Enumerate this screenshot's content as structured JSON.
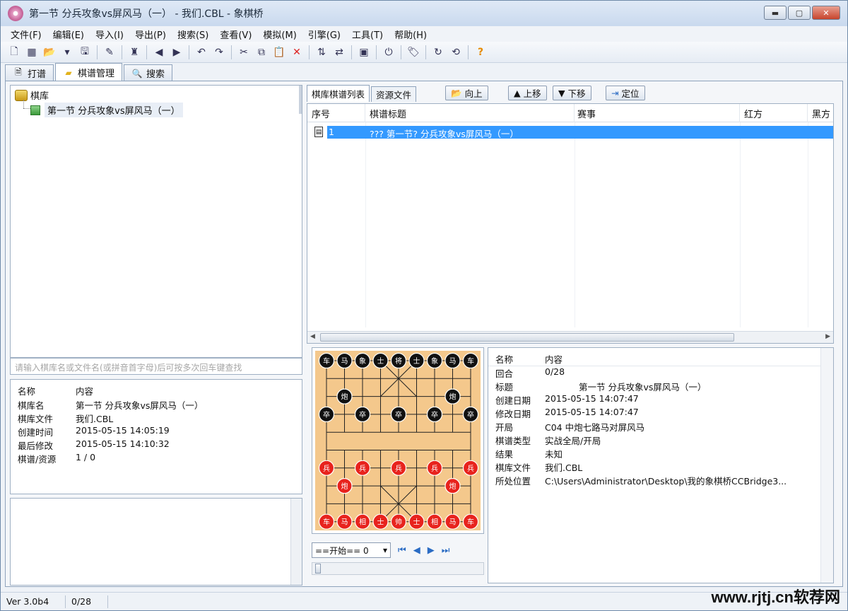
{
  "window": {
    "title": "第一节  分兵攻象vs屏风马（一） - 我们.CBL - 象棋桥",
    "controls": {
      "minimize": "▬",
      "maximize": "▢",
      "close": "✕"
    }
  },
  "menu": [
    "文件(F)",
    "编辑(E)",
    "导入(I)",
    "导出(P)",
    "搜索(S)",
    "查看(V)",
    "模拟(M)",
    "引擎(G)",
    "工具(T)",
    "帮助(H)"
  ],
  "toolbar": {
    "buttons": [
      {
        "name": "new-file-icon",
        "glyph": "🗋"
      },
      {
        "name": "board-icon",
        "glyph": "▦"
      },
      {
        "name": "open-icon",
        "glyph": "📂"
      },
      {
        "name": "dropdown-icon",
        "glyph": "▾"
      },
      {
        "name": "save-icon",
        "glyph": "🖫"
      },
      {
        "sep": true
      },
      {
        "name": "edit-icon",
        "glyph": "✎"
      },
      {
        "sep": true
      },
      {
        "name": "piece-icon",
        "glyph": "♜"
      },
      {
        "sep": true
      },
      {
        "name": "back-icon",
        "glyph": "◀"
      },
      {
        "name": "forward-icon",
        "glyph": "▶"
      },
      {
        "sep": true
      },
      {
        "name": "undo-icon",
        "glyph": "↶"
      },
      {
        "name": "redo-icon",
        "glyph": "↷"
      },
      {
        "sep": true
      },
      {
        "name": "cut-icon",
        "glyph": "✂"
      },
      {
        "name": "copy-icon",
        "glyph": "⧉"
      },
      {
        "name": "paste-icon",
        "glyph": "📋"
      },
      {
        "name": "delete-icon",
        "glyph": "✕"
      },
      {
        "sep": true
      },
      {
        "name": "sort-icon",
        "glyph": "⇅"
      },
      {
        "name": "swap-icon",
        "glyph": "⇄"
      },
      {
        "sep": true
      },
      {
        "name": "window-icon",
        "glyph": "▣"
      },
      {
        "sep": true
      },
      {
        "name": "power-icon",
        "glyph": "⏻"
      },
      {
        "sep": true
      },
      {
        "name": "tag-icon",
        "glyph": "🏷"
      },
      {
        "sep": true
      },
      {
        "name": "refresh-icon",
        "glyph": "↻"
      },
      {
        "name": "sync-icon",
        "glyph": "⟲"
      },
      {
        "sep": true
      },
      {
        "name": "help-icon",
        "glyph": "?"
      }
    ]
  },
  "tabs": [
    {
      "label": "打谱",
      "icon": "document-icon",
      "glyph": "🗎",
      "active": false
    },
    {
      "label": "棋谱管理",
      "icon": "folder-icon",
      "glyph": "▰",
      "active": true
    },
    {
      "label": "搜索",
      "icon": "search-icon",
      "glyph": "🔍",
      "active": false
    }
  ],
  "tree": {
    "root": "棋库",
    "child": "第一节  分兵攻象vs屏风马（一）"
  },
  "search": {
    "placeholder": "请输入棋库名或文件名(或拼音首字母)后可按多次回车键查找"
  },
  "library_info": {
    "head": {
      "k": "名称",
      "v": "内容"
    },
    "rows": [
      {
        "k": "棋库名",
        "v": "第一节  分兵攻象vs屏风马（一）"
      },
      {
        "k": "棋库文件",
        "v": "我们.CBL"
      },
      {
        "k": "创建时间",
        "v": "2015-05-15 14:05:19"
      },
      {
        "k": "最后修改",
        "v": "2015-05-15 14:10:32"
      },
      {
        "k": "棋谱/资源",
        "v": "1 / 0"
      }
    ]
  },
  "sub_tabs": [
    "棋库棋谱列表",
    "资源文件"
  ],
  "actions": {
    "up_level": "向上",
    "move_up": "上移",
    "move_down": "下移",
    "locate": "定位"
  },
  "list": {
    "columns": [
      "序号",
      "棋谱标题",
      "赛事",
      "红方",
      "黑方"
    ],
    "rows": [
      {
        "index": "1",
        "title": "??? 第一节? 分兵攻象vs屏风马（一）",
        "event": "",
        "red": "",
        "black": ""
      }
    ]
  },
  "board": {
    "black_pieces": [
      {
        "t": "车",
        "c": 0,
        "r": 0
      },
      {
        "t": "马",
        "c": 1,
        "r": 0
      },
      {
        "t": "象",
        "c": 2,
        "r": 0
      },
      {
        "t": "士",
        "c": 3,
        "r": 0
      },
      {
        "t": "将",
        "c": 4,
        "r": 0
      },
      {
        "t": "士",
        "c": 5,
        "r": 0
      },
      {
        "t": "象",
        "c": 6,
        "r": 0
      },
      {
        "t": "马",
        "c": 7,
        "r": 0
      },
      {
        "t": "车",
        "c": 8,
        "r": 0
      },
      {
        "t": "炮",
        "c": 1,
        "r": 2
      },
      {
        "t": "炮",
        "c": 7,
        "r": 2
      },
      {
        "t": "卒",
        "c": 0,
        "r": 3
      },
      {
        "t": "卒",
        "c": 2,
        "r": 3
      },
      {
        "t": "卒",
        "c": 4,
        "r": 3
      },
      {
        "t": "卒",
        "c": 6,
        "r": 3
      },
      {
        "t": "卒",
        "c": 8,
        "r": 3
      }
    ],
    "red_pieces": [
      {
        "t": "兵",
        "c": 0,
        "r": 6
      },
      {
        "t": "兵",
        "c": 2,
        "r": 6
      },
      {
        "t": "兵",
        "c": 4,
        "r": 6
      },
      {
        "t": "兵",
        "c": 6,
        "r": 6
      },
      {
        "t": "兵",
        "c": 8,
        "r": 6
      },
      {
        "t": "炮",
        "c": 1,
        "r": 7
      },
      {
        "t": "炮",
        "c": 7,
        "r": 7
      },
      {
        "t": "车",
        "c": 0,
        "r": 9
      },
      {
        "t": "马",
        "c": 1,
        "r": 9
      },
      {
        "t": "相",
        "c": 2,
        "r": 9
      },
      {
        "t": "士",
        "c": 3,
        "r": 9
      },
      {
        "t": "帅",
        "c": 4,
        "r": 9
      },
      {
        "t": "士",
        "c": 5,
        "r": 9
      },
      {
        "t": "相",
        "c": 6,
        "r": 9
      },
      {
        "t": "马",
        "c": 7,
        "r": 9
      },
      {
        "t": "车",
        "c": 8,
        "r": 9
      }
    ],
    "colors": {
      "board": "#f4c88c",
      "line": "#222222",
      "black_piece": "#111111",
      "red_piece": "#e8231d"
    }
  },
  "moves": {
    "selected": "==开始==  0"
  },
  "nav": [
    "⏮",
    "◀",
    "▶",
    "⏭"
  ],
  "details": {
    "head": {
      "k": "名称",
      "v": "内容"
    },
    "rows": [
      {
        "k": "回合",
        "v": "0/28"
      },
      {
        "k": "标题",
        "v": "第一节    分兵攻象vs屏风马（一）"
      },
      {
        "k": "创建日期",
        "v": "2015-05-15 14:07:47"
      },
      {
        "k": "修改日期",
        "v": "2015-05-15 14:07:47"
      },
      {
        "k": "开局",
        "v": "C04 中炮七路马对屏风马"
      },
      {
        "k": "棋谱类型",
        "v": "实战全局/开局"
      },
      {
        "k": "结果",
        "v": "未知"
      },
      {
        "k": "棋库文件",
        "v": "我们.CBL"
      },
      {
        "k": "所处位置",
        "v": "C:\\Users\\Administrator\\Desktop\\我的象棋桥CCBridge3..."
      }
    ]
  },
  "status": {
    "version": "Ver 3.0b4",
    "moves": "0/28"
  },
  "watermark": "www.rjtj.cn软荐网"
}
